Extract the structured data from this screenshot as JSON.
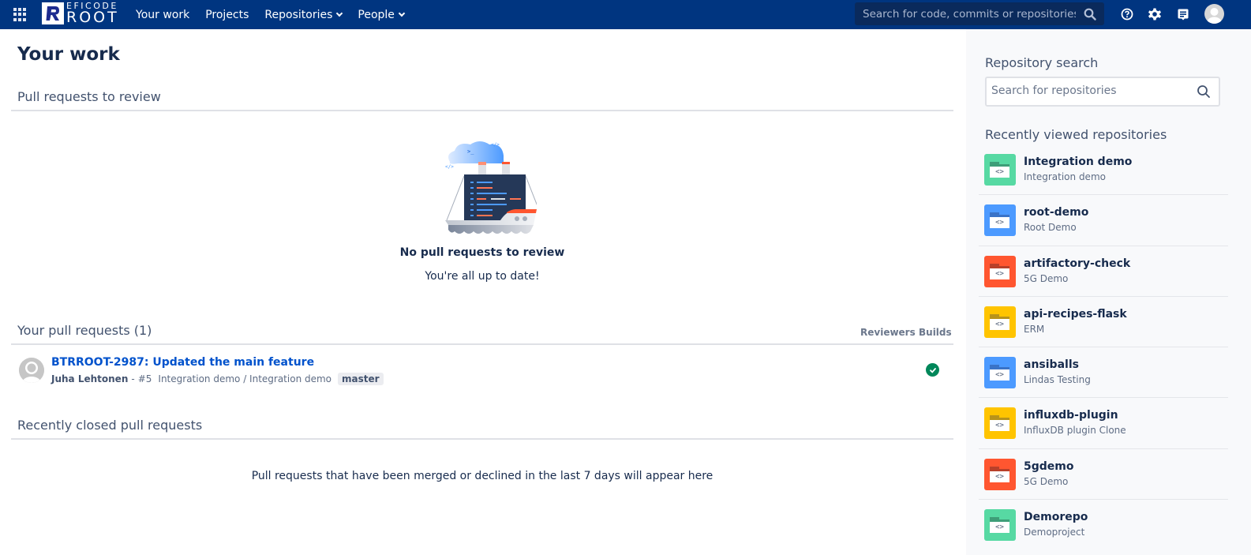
{
  "header": {
    "logo": {
      "top": "EFICODE",
      "bottom": "ROOT",
      "mark": "R"
    },
    "nav": [
      {
        "label": "Your work",
        "dropdown": false
      },
      {
        "label": "Projects",
        "dropdown": false
      },
      {
        "label": "Repositories",
        "dropdown": true
      },
      {
        "label": "People",
        "dropdown": true
      }
    ],
    "search_placeholder": "Search for code, commits or repositories...",
    "icons": [
      "help-icon",
      "settings-icon",
      "notes-icon",
      "user-avatar"
    ]
  },
  "main": {
    "title": "Your work",
    "review": {
      "title": "Pull requests to review",
      "empty_title": "No pull requests to review",
      "empty_sub": "You're all up to date!"
    },
    "yours": {
      "title": "Your pull requests (1)",
      "columns": [
        "Reviewers",
        "Builds"
      ],
      "items": [
        {
          "title": "BTRROOT-2987: Updated the main feature",
          "author": "Juha Lehtonen",
          "number": "#5",
          "repo": "Integration demo / Integration demo",
          "branch": "master",
          "build_status": "success"
        }
      ]
    },
    "closed": {
      "title": "Recently closed pull requests",
      "empty": "Pull requests that have been merged or declined in the last 7 days will appear here"
    }
  },
  "sidebar": {
    "search_title": "Repository search",
    "search_placeholder": "Search for repositories",
    "recent_title": "Recently viewed repositories",
    "repos": [
      {
        "name": "Integration demo",
        "project": "Integration demo",
        "color": "#57d9a3",
        "dark": "#3e9e78"
      },
      {
        "name": "root-demo",
        "project": "Root Demo",
        "color": "#4c9aff",
        "dark": "#3a73c7"
      },
      {
        "name": "artifactory-check",
        "project": "5G Demo",
        "color": "#ff5630",
        "dark": "#b8402a"
      },
      {
        "name": "api-recipes-flask",
        "project": "ERM",
        "color": "#ffc400",
        "dark": "#b8931a"
      },
      {
        "name": "ansiballs",
        "project": "Lindas Testing",
        "color": "#4c9aff",
        "dark": "#3a73c7"
      },
      {
        "name": "influxdb-plugin",
        "project": "InfluxDB plugin Clone",
        "color": "#ffc400",
        "dark": "#b8931a"
      },
      {
        "name": "5gdemo",
        "project": "5G Demo",
        "color": "#ff5630",
        "dark": "#b8402a"
      },
      {
        "name": "Demorepo",
        "project": "Demoproject",
        "color": "#57d9a3",
        "dark": "#3e9e78"
      }
    ],
    "repo_icon_glyph": "<>"
  }
}
